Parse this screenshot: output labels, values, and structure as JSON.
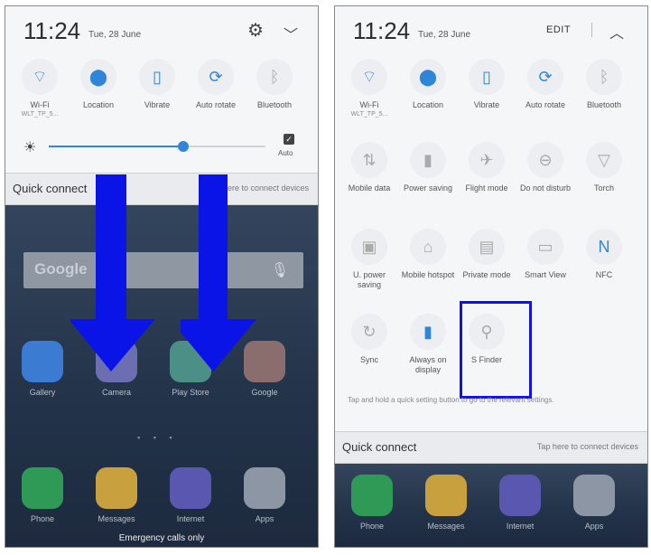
{
  "left": {
    "time": "11:24",
    "date": "Tue, 28 June",
    "toggles": [
      {
        "label": "Wi-Fi",
        "sub": "WLT_TP_5...",
        "icon": "wifi-icon",
        "glyph": "⌔",
        "state": "on"
      },
      {
        "label": "Location",
        "sub": "",
        "icon": "location-icon",
        "glyph": "⬤",
        "state": "on"
      },
      {
        "label": "Vibrate",
        "sub": "",
        "icon": "vibrate-icon",
        "glyph": "▯",
        "state": "on"
      },
      {
        "label": "Auto rotate",
        "sub": "",
        "icon": "rotate-icon",
        "glyph": "⟳",
        "state": "on"
      },
      {
        "label": "Bluetooth",
        "sub": "",
        "icon": "bluetooth-icon",
        "glyph": "ᛒ",
        "state": "off"
      }
    ],
    "brightness": {
      "level": 0.62,
      "auto_label": "Auto"
    },
    "quick_connect": {
      "title": "Quick connect",
      "hint": "Tap here to connect devices"
    },
    "search_text": "Google",
    "apps_row": [
      {
        "label": "Gallery",
        "color": "#3b7bd2"
      },
      {
        "label": "Camera",
        "color": "#6b6fb2"
      },
      {
        "label": "Play Store",
        "color": "#4c8f86"
      },
      {
        "label": "Google",
        "color": "#8a6e6e"
      }
    ],
    "dock": [
      {
        "label": "Phone",
        "color": "#2e9a56"
      },
      {
        "label": "Messages",
        "color": "#c8a03e"
      },
      {
        "label": "Internet",
        "color": "#5a57b0"
      },
      {
        "label": "Apps",
        "color": "#8d96a5"
      }
    ],
    "emergency": "Emergency calls only",
    "arrow_color": "#0a14e6"
  },
  "right": {
    "time": "11:24",
    "date": "Tue, 28 June",
    "edit_label": "EDIT",
    "row1": [
      {
        "label": "Wi-Fi",
        "sub": "WLT_TP_5...",
        "icon": "wifi-icon",
        "glyph": "⌔",
        "state": "on"
      },
      {
        "label": "Location",
        "sub": "",
        "icon": "location-icon",
        "glyph": "⬤",
        "state": "on"
      },
      {
        "label": "Vibrate",
        "sub": "",
        "icon": "vibrate-icon",
        "glyph": "▯",
        "state": "on"
      },
      {
        "label": "Auto rotate",
        "sub": "",
        "icon": "rotate-icon",
        "glyph": "⟳",
        "state": "on"
      },
      {
        "label": "Bluetooth",
        "sub": "",
        "icon": "bluetooth-icon",
        "glyph": "ᛒ",
        "state": "off"
      }
    ],
    "row2": [
      {
        "label": "Mobile data",
        "icon": "mobile-data-icon",
        "glyph": "⇅",
        "state": "off"
      },
      {
        "label": "Power saving",
        "icon": "battery-icon",
        "glyph": "▮",
        "state": "off"
      },
      {
        "label": "Flight mode",
        "icon": "airplane-icon",
        "glyph": "✈",
        "state": "off"
      },
      {
        "label": "Do not disturb",
        "icon": "do-not-disturb-icon",
        "glyph": "⊖",
        "state": "off"
      },
      {
        "label": "Torch",
        "icon": "torch-icon",
        "glyph": "▽",
        "state": "off"
      }
    ],
    "row3": [
      {
        "label": "U. power saving",
        "icon": "ultra-power-icon",
        "glyph": "▣",
        "state": "off"
      },
      {
        "label": "Mobile hotspot",
        "icon": "hotspot-icon",
        "glyph": "⌂",
        "state": "off"
      },
      {
        "label": "Private mode",
        "icon": "private-mode-icon",
        "glyph": "▤",
        "state": "off"
      },
      {
        "label": "Smart View",
        "icon": "smart-view-icon",
        "glyph": "▭",
        "state": "off"
      },
      {
        "label": "NFC",
        "icon": "nfc-icon",
        "glyph": "N",
        "state": "on"
      }
    ],
    "row4": [
      {
        "label": "Sync",
        "icon": "sync-icon",
        "glyph": "↻",
        "state": "off"
      },
      {
        "label": "Always on display",
        "icon": "always-on-display-icon",
        "glyph": "▮",
        "state": "on"
      },
      {
        "label": "S Finder",
        "icon": "search-icon",
        "glyph": "⚲",
        "state": "off"
      }
    ],
    "note": "Tap and hold a quick setting button to go to the relevant settings.",
    "quick_connect": {
      "title": "Quick connect",
      "hint": "Tap here to connect devices"
    },
    "dock": [
      {
        "label": "Phone",
        "color": "#2e9a56"
      },
      {
        "label": "Messages",
        "color": "#c8a03e"
      },
      {
        "label": "Internet",
        "color": "#5a57b0"
      },
      {
        "label": "Apps",
        "color": "#8d96a5"
      }
    ],
    "highlight_color": "#1010ee"
  }
}
